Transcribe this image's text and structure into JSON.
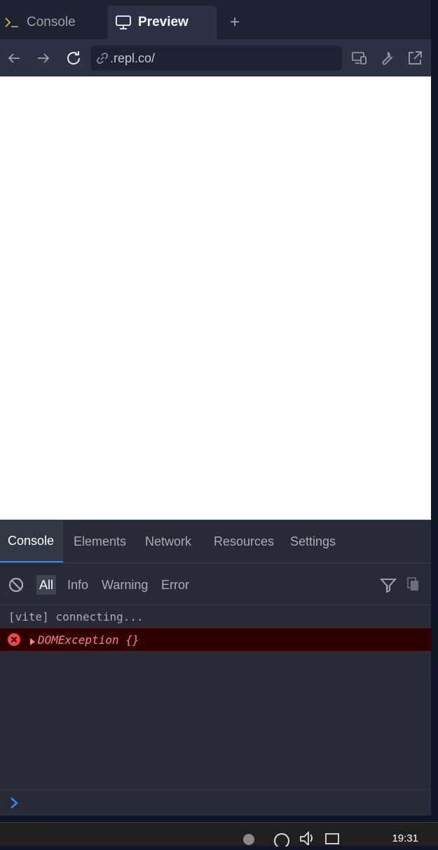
{
  "tabs": {
    "console_label": "Console",
    "preview_label": "Preview",
    "add_label": "+"
  },
  "address": {
    "url": ".repl.co/"
  },
  "devtools": {
    "tabs": [
      "Console",
      "Elements",
      "Network",
      "Resources",
      "Settings"
    ],
    "filters": [
      "All",
      "Info",
      "Warning",
      "Error"
    ],
    "active_filter": "All",
    "logs": {
      "info": "[vite] connecting...",
      "error": "DOMException {}"
    }
  },
  "taskbar": {
    "time": "19:31"
  },
  "colors": {
    "accent": "#3b82f6",
    "error_bg": "#2f0000",
    "error_text": "#ff8080"
  }
}
